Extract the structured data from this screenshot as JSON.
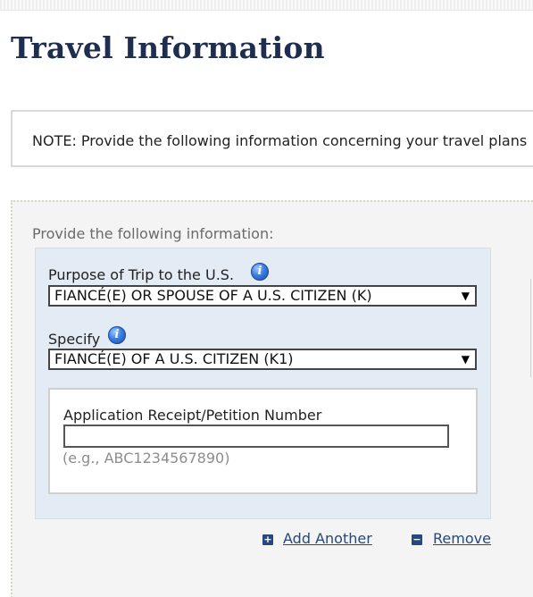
{
  "page": {
    "title": "Travel Information"
  },
  "note": {
    "text": "NOTE: Provide the following information concerning your travel plans"
  },
  "section": {
    "heading": "Provide the following information:"
  },
  "purpose": {
    "label": "Purpose of Trip to the U.S.",
    "selected": "FIANCÉ(E) OR SPOUSE OF A U.S. CITIZEN (K)",
    "help_icon": "info-icon"
  },
  "specify": {
    "label": "Specify",
    "selected": "FIANCÉ(E) OF A U.S. CITIZEN (K1)",
    "help_icon": "info-icon"
  },
  "receipt": {
    "label": "Application Receipt/Petition Number",
    "value": "",
    "example": "(e.g., ABC1234567890)"
  },
  "actions": {
    "add_label": "Add Another",
    "remove_label": "Remove",
    "add_icon": "plus-icon",
    "remove_icon": "minus-icon"
  },
  "colors": {
    "title": "#1f2d4f",
    "panel_bg": "#e3ebf4",
    "link": "#26487a",
    "example": "#8d8d8d"
  }
}
